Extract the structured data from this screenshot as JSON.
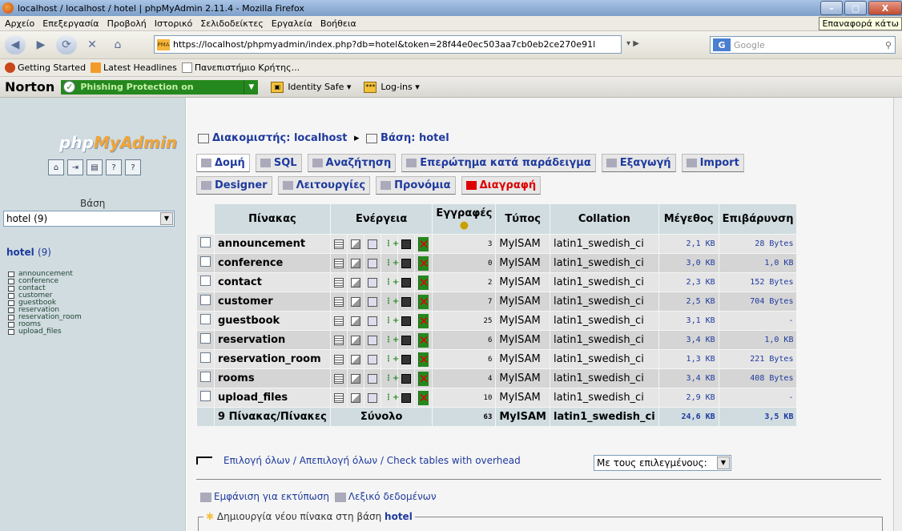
{
  "window": {
    "title": "localhost / localhost / hotel | phpMyAdmin 2.11.4 - Mozilla Firefox",
    "min": "–",
    "max": "▢",
    "close": "X"
  },
  "menu": {
    "items": [
      "Αρχείο",
      "Επεξεργασία",
      "Προβολή",
      "Ιστορικό",
      "Σελιδοδείκτες",
      "Εργαλεία",
      "Βοήθεια"
    ],
    "tooltip": "Επαναφορά κάτω"
  },
  "nav": {
    "url": "https://localhost/phpmyadmin/index.php?db=hotel&token=28f44e0ec503aa7cb0eb2ce270e91l",
    "search_placeholder": "Google"
  },
  "bookmarks": [
    "Getting Started",
    "Latest Headlines",
    "Πανεπιστήμιο Κρήτης..."
  ],
  "norton": {
    "logo": "Norton",
    "phishing": "Phishing Protection on",
    "identity": "Identity Safe ▾",
    "logins": "Log-ins ▾"
  },
  "left": {
    "logo_a": "php",
    "logo_b": "MyAdmin",
    "db_label": "Βάση",
    "db_select": "hotel (9)",
    "db_name": "hotel",
    "db_count": "(9)",
    "tables": [
      "announcement",
      "conference",
      "contact",
      "customer",
      "guestbook",
      "reservation",
      "reservation_room",
      "rooms",
      "upload_files"
    ]
  },
  "main": {
    "breadcrumb_server": "Διακομιστής: localhost",
    "breadcrumb_sep": "▸",
    "breadcrumb_db": "Βάση: hotel",
    "tabs": [
      "Δομή",
      "SQL",
      "Αναζήτηση",
      "Επερώτημα κατά παράδειγμα",
      "Εξαγωγή",
      "Import",
      "Designer",
      "Λειτουργίες",
      "Προνόμια",
      "Διαγραφή"
    ],
    "headers": {
      "table": "Πίνακας",
      "action": "Ενέργεια",
      "records": "Εγγραφές",
      "type": "Τύπος",
      "collation": "Collation",
      "size": "Μέγεθος",
      "overhead": "Επιβάρυνση"
    },
    "rows": [
      {
        "name": "announcement",
        "records": "3",
        "type": "MyISAM",
        "collation": "latin1_swedish_ci",
        "size": "2,1 KB",
        "overhead": "28 Bytes"
      },
      {
        "name": "conference",
        "records": "0",
        "type": "MyISAM",
        "collation": "latin1_swedish_ci",
        "size": "3,0 KB",
        "overhead": "1,0 KB"
      },
      {
        "name": "contact",
        "records": "2",
        "type": "MyISAM",
        "collation": "latin1_swedish_ci",
        "size": "2,3 KB",
        "overhead": "152 Bytes"
      },
      {
        "name": "customer",
        "records": "7",
        "type": "MyISAM",
        "collation": "latin1_swedish_ci",
        "size": "2,5 KB",
        "overhead": "704 Bytes"
      },
      {
        "name": "guestbook",
        "records": "25",
        "type": "MyISAM",
        "collation": "latin1_swedish_ci",
        "size": "3,1 KB",
        "overhead": "-"
      },
      {
        "name": "reservation",
        "records": "6",
        "type": "MyISAM",
        "collation": "latin1_swedish_ci",
        "size": "3,4 KB",
        "overhead": "1,0 KB"
      },
      {
        "name": "reservation_room",
        "records": "6",
        "type": "MyISAM",
        "collation": "latin1_swedish_ci",
        "size": "1,3 KB",
        "overhead": "221 Bytes"
      },
      {
        "name": "rooms",
        "records": "4",
        "type": "MyISAM",
        "collation": "latin1_swedish_ci",
        "size": "3,4 KB",
        "overhead": "408 Bytes"
      },
      {
        "name": "upload_files",
        "records": "10",
        "type": "MyISAM",
        "collation": "latin1_swedish_ci",
        "size": "2,9 KB",
        "overhead": "-"
      }
    ],
    "footer": {
      "count": "9 Πίνακας/Πίνακες",
      "sum_label": "Σύνολο",
      "records": "63",
      "type": "MyISAM",
      "collation": "latin1_swedish_ci",
      "size": "24,6 KB",
      "overhead": "3,5 KB"
    },
    "select_links": "Επιλογή όλων / Απεπιλογή όλων / Check tables with overhead",
    "with_selected": "Με τους επιλεγμένους:",
    "print_view": "Εμφάνιση για εκτύπωση",
    "data_dict": "Λεξικό δεδομένων",
    "create_label": "Δημιουργία νέου πίνακα στη βάση",
    "create_db": "hotel"
  }
}
